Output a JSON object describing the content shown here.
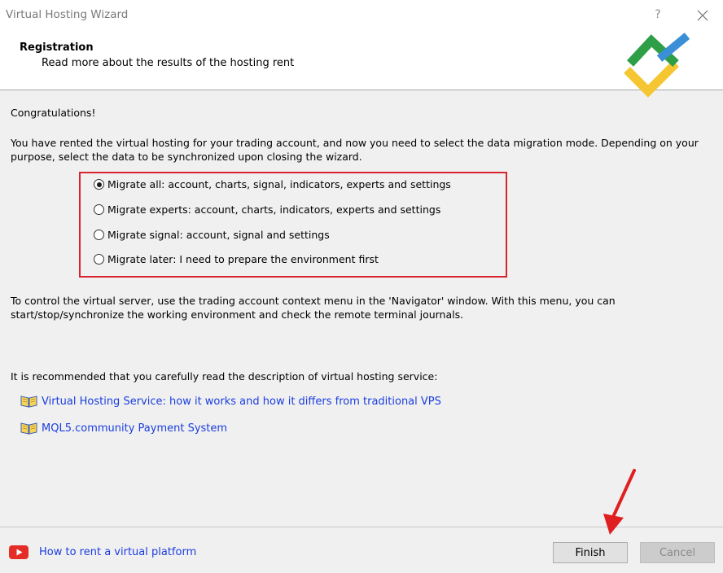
{
  "window": {
    "title": "Virtual Hosting Wizard",
    "help": "?"
  },
  "header": {
    "title": "Registration",
    "subtitle": "Read more about the results of the hosting rent"
  },
  "body": {
    "congrats": "Congratulations!",
    "intro": "You have rented the virtual hosting for your trading account, and now you need to select the data migration mode. Depending on your purpose, select the data to be synchronized upon closing the wizard.",
    "options": [
      {
        "label": "Migrate all: account, charts, signal, indicators, experts and settings",
        "selected": true
      },
      {
        "label": "Migrate experts: account, charts, indicators, experts and settings",
        "selected": false
      },
      {
        "label": "Migrate signal: account, signal and settings",
        "selected": false
      },
      {
        "label": "Migrate later: I need to prepare the environment first",
        "selected": false
      }
    ],
    "control_text": "To control the virtual server, use the trading account context menu in the 'Navigator' window. With this menu, you can start/stop/synchronize the working environment and check the remote terminal journals.",
    "recommend": "It is recommended that you carefully read the description of virtual hosting service:",
    "links": [
      {
        "label": "Virtual Hosting Service: how it works and how it differs from traditional VPS",
        "icon": "book-icon"
      },
      {
        "label": "MQL5.community Payment System",
        "icon": "book-icon"
      }
    ]
  },
  "footer": {
    "video_link": "How to rent a virtual platform",
    "finish_label": "Finish",
    "cancel_label": "Cancel"
  },
  "colors": {
    "highlight_border": "#d9232e",
    "link": "#1a3de0",
    "logo_green": "#2e9e47",
    "logo_blue": "#3b8fd6",
    "logo_yellow": "#f5c632",
    "youtube_red": "#e52d27"
  }
}
